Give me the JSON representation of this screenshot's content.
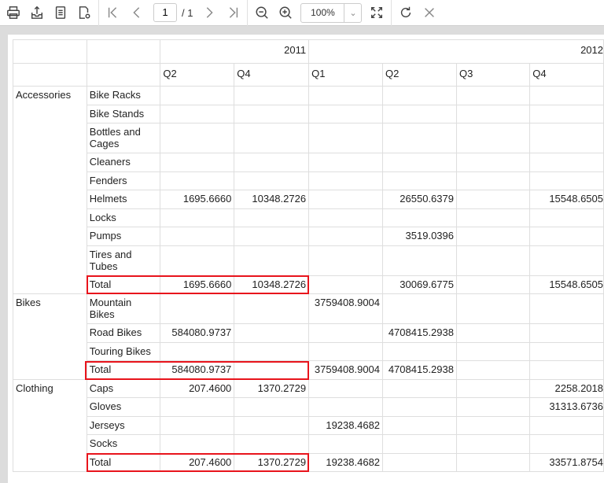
{
  "toolbar": {
    "page_current": "1",
    "page_total": "/ 1",
    "zoom": "100%"
  },
  "table": {
    "years": [
      "2011",
      "2012"
    ],
    "quarters": [
      "Q2",
      "Q4",
      "Q1",
      "Q2",
      "Q3",
      "Q4"
    ],
    "rows": [
      {
        "cat": "Accessories",
        "sub": "Bike Racks",
        "v": [
          "",
          "",
          "",
          "",
          "",
          ""
        ]
      },
      {
        "cat": "",
        "sub": "Bike Stands",
        "v": [
          "",
          "",
          "",
          "",
          "",
          ""
        ]
      },
      {
        "cat": "",
        "sub": "Bottles and Cages",
        "v": [
          "",
          "",
          "",
          "",
          "",
          ""
        ],
        "tall": true
      },
      {
        "cat": "",
        "sub": "Cleaners",
        "v": [
          "",
          "",
          "",
          "",
          "",
          ""
        ]
      },
      {
        "cat": "",
        "sub": "Fenders",
        "v": [
          "",
          "",
          "",
          "",
          "",
          ""
        ]
      },
      {
        "cat": "",
        "sub": "Helmets",
        "v": [
          "1695.6660",
          "10348.2726",
          "",
          "26550.6379",
          "",
          "15548.6505"
        ]
      },
      {
        "cat": "",
        "sub": "Locks",
        "v": [
          "",
          "",
          "",
          "",
          "",
          ""
        ]
      },
      {
        "cat": "",
        "sub": "Pumps",
        "v": [
          "",
          "",
          "",
          "3519.0396",
          "",
          ""
        ]
      },
      {
        "cat": "",
        "sub": "Tires and Tubes",
        "v": [
          "",
          "",
          "",
          "",
          "",
          ""
        ],
        "tall": true
      },
      {
        "cat": "",
        "sub": "Total",
        "v": [
          "1695.6660",
          "10348.2726",
          "",
          "30069.6775",
          "",
          "15548.6505"
        ]
      },
      {
        "cat": "Bikes",
        "sub": "Mountain Bikes",
        "v": [
          "",
          "",
          "3759408.9004",
          "",
          "",
          ""
        ],
        "tall": true
      },
      {
        "cat": "",
        "sub": "Road Bikes",
        "v": [
          "584080.9737",
          "",
          "",
          "4708415.2938",
          "",
          ""
        ]
      },
      {
        "cat": "",
        "sub": "Touring Bikes",
        "v": [
          "",
          "",
          "",
          "",
          "",
          ""
        ]
      },
      {
        "cat": "",
        "sub": "Total",
        "v": [
          "584080.9737",
          "",
          "3759408.9004",
          "4708415.2938",
          "",
          ""
        ]
      },
      {
        "cat": "Clothing",
        "sub": "Caps",
        "v": [
          "207.4600",
          "1370.2729",
          "",
          "",
          "",
          "2258.2018"
        ]
      },
      {
        "cat": "",
        "sub": "Gloves",
        "v": [
          "",
          "",
          "",
          "",
          "",
          "31313.6736"
        ]
      },
      {
        "cat": "",
        "sub": "Jerseys",
        "v": [
          "",
          "",
          "19238.4682",
          "",
          "",
          ""
        ]
      },
      {
        "cat": "",
        "sub": "Socks",
        "v": [
          "",
          "",
          "",
          "",
          "",
          ""
        ]
      },
      {
        "cat": "",
        "sub": "Total",
        "v": [
          "207.4600",
          "1370.2729",
          "19238.4682",
          "",
          "",
          "33571.8754"
        ]
      }
    ]
  }
}
